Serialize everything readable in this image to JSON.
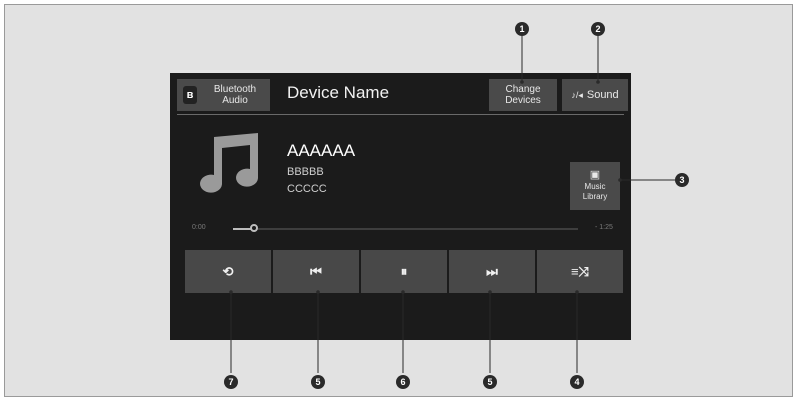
{
  "header": {
    "bluetooth_icon_glyph": "ʙ",
    "source_label": "Bluetooth Audio",
    "device_name": "Device Name",
    "change_devices_label": "Change Devices",
    "sound_icon_glyph": "♪/◂",
    "sound_label": "Sound"
  },
  "track": {
    "title": "AAAAAA",
    "line2": "BBBBB",
    "line3": "CCCCC"
  },
  "music_library": {
    "icon_glyph": "▣",
    "label": "Music Library"
  },
  "progress": {
    "elapsed": "0:00",
    "remaining": "- 1:25",
    "fraction": 0.06
  },
  "controls": [
    {
      "name": "repeat-button",
      "glyph": "⟲"
    },
    {
      "name": "skip-back-button",
      "glyph": "⏮"
    },
    {
      "name": "pause-button",
      "glyph": "⏸"
    },
    {
      "name": "skip-forward-button",
      "glyph": "⏭"
    },
    {
      "name": "shuffle-button",
      "glyph": "≡⤨"
    }
  ],
  "callouts": [
    "1",
    "2",
    "3",
    "4",
    "5",
    "6",
    "5",
    "7"
  ],
  "colors": {
    "screen_bg": "#1b1b1b",
    "button_bg": "#484848",
    "frame_bg": "#e2e2e2"
  }
}
